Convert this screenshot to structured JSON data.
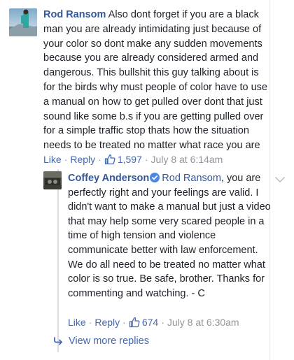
{
  "top_comment": {
    "author": "Rod Ransom",
    "text": "Also dont forget if you are a black man you are already intimidating just because of your color so dont make any sudden movements because you are already considered armed and dangerous. This bullshit this guy talking about is for the birds why must people of color have to use a manual on how to get pulled over dont that just sound like some b.s if you are getting pulled over for a simple traffic stop thats how the situation needs to be treated no matter what race you are",
    "actions": {
      "like": "Like",
      "reply": "Reply",
      "like_count": "1,597",
      "timestamp": "July 8 at 6:14am"
    }
  },
  "reply": {
    "author": "Coffey Anderson",
    "mention": "Rod Ransom",
    "text": ", you are perfectly right and your feelings are valid. I didn't want to make a manual but just a video that may help some very scared people in a time of high tension and violence communicate better with law enforcement. We do all need to be treated no matter what color is so true. Be safe, brother. Thanks for commenting and watching. - C",
    "actions": {
      "like": "Like",
      "reply": "Reply",
      "like_count": "674",
      "timestamp": "July 8 at 6:30am"
    }
  },
  "view_more": "View more replies",
  "icons": {
    "thumb": "thumbs-up-icon",
    "verified": "verified-badge-icon",
    "chevron": "chevron-down-icon",
    "reply_arrow": "reply-arrow-icon"
  },
  "colors": {
    "link": "#4267b2",
    "author": "#365899",
    "meta": "#90949c",
    "text": "#1d2129"
  }
}
